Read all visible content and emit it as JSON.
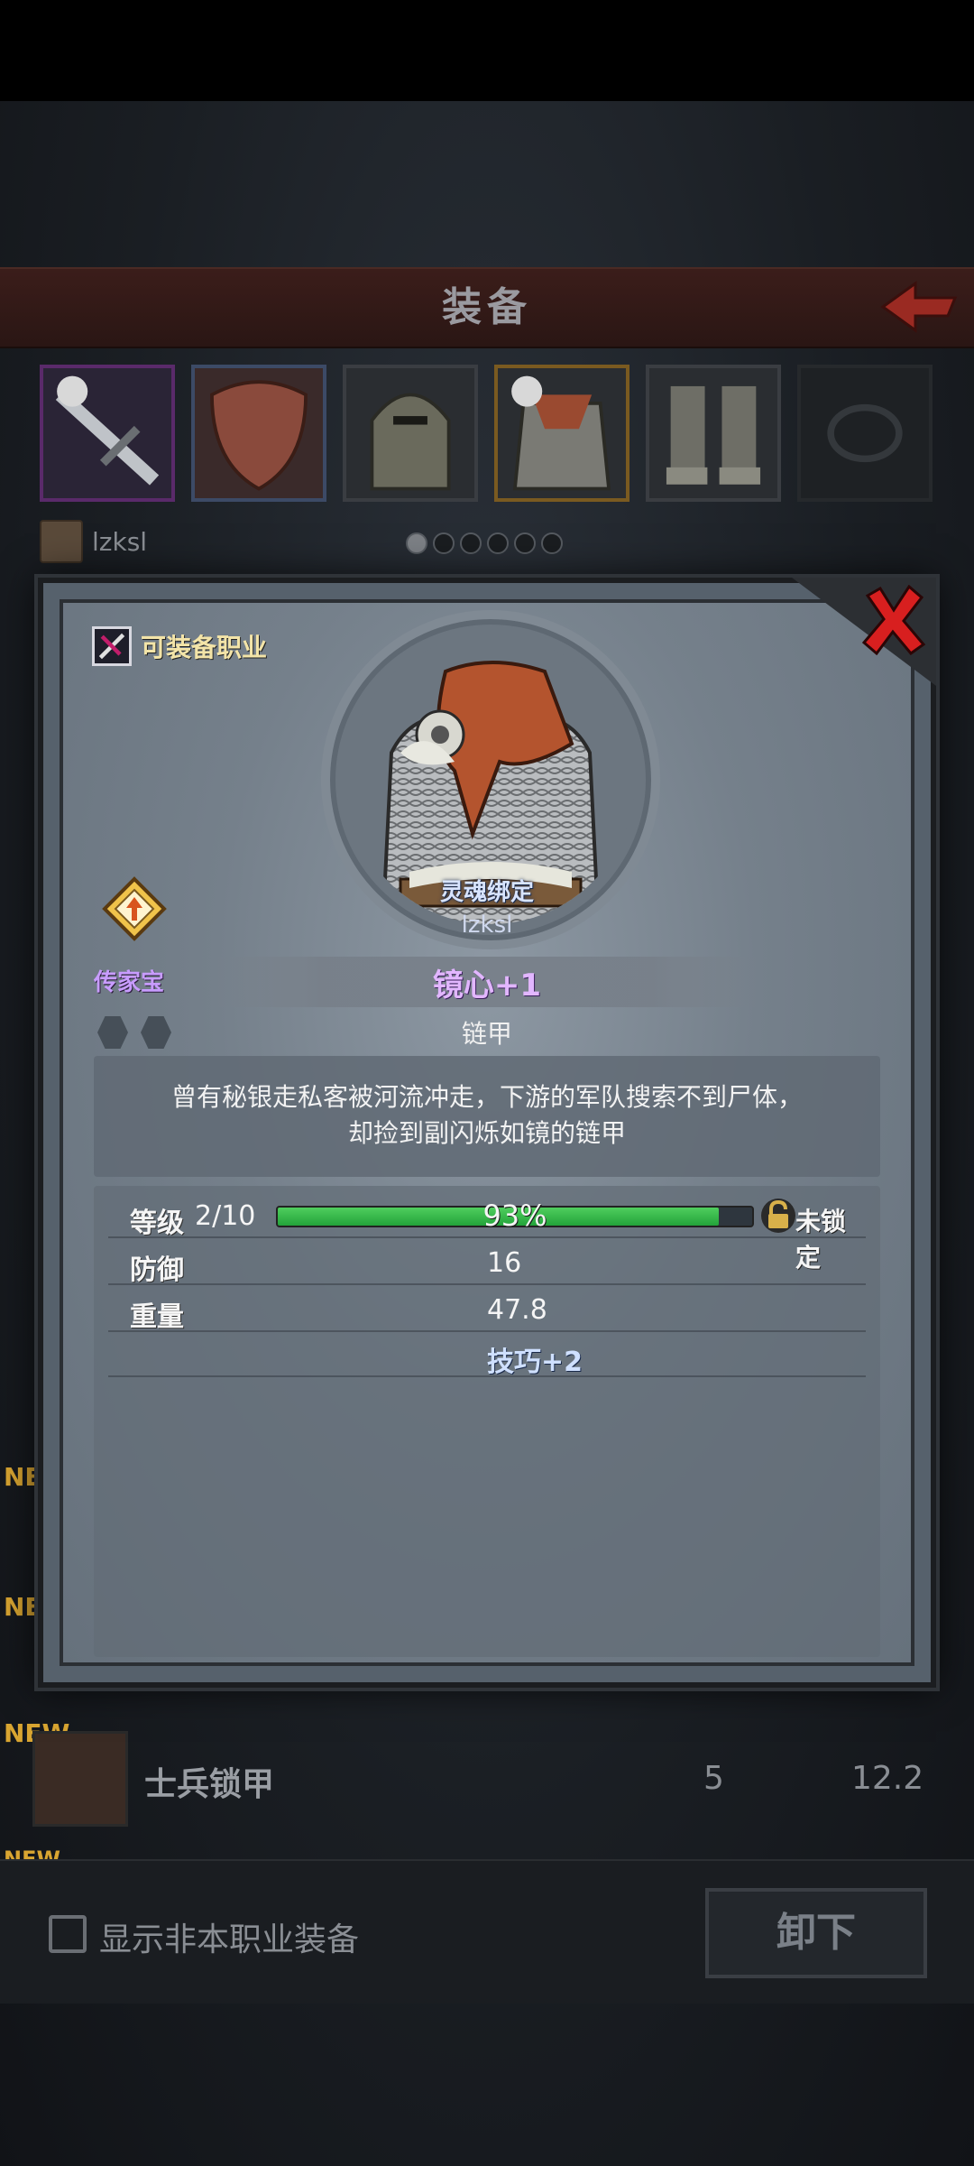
{
  "screen": {
    "title": "装备",
    "owner_name": "lzksl",
    "pager_dots": 6,
    "pager_active": 0
  },
  "list": {
    "new_tag": "NEW",
    "visible_item": {
      "name": "士兵锁甲",
      "defense": "5",
      "weight": "12.2"
    }
  },
  "bottom": {
    "show_other_class_label": "显示非本职业装备",
    "unequip_label": "卸下"
  },
  "modal": {
    "class_label": "可装备职业",
    "soulbound_label": "灵魂绑定",
    "owner": "lzksl",
    "heirloom_label": "传家宝",
    "item_name": "镜心+1",
    "item_type": "链甲",
    "description_line1": "曾有秘银走私客被河流冲走，下游的军队搜索不到尸体，",
    "description_line2": "却捡到副闪烁如镜的链甲",
    "stats": {
      "level_label": "等级",
      "level_value": "2/10",
      "xp_percent_text": "93%",
      "xp_fraction": 0.93,
      "lock_label": "未锁定",
      "defense_label": "防御",
      "defense_value": "16",
      "weight_label": "重量",
      "weight_value": "47.8",
      "bonus": "技巧+2"
    }
  },
  "colors": {
    "heirloom": "#c89cff",
    "item_name": "#e2b6ff",
    "xp_bar": "#2fb544",
    "close_x": "#d81f1f"
  }
}
